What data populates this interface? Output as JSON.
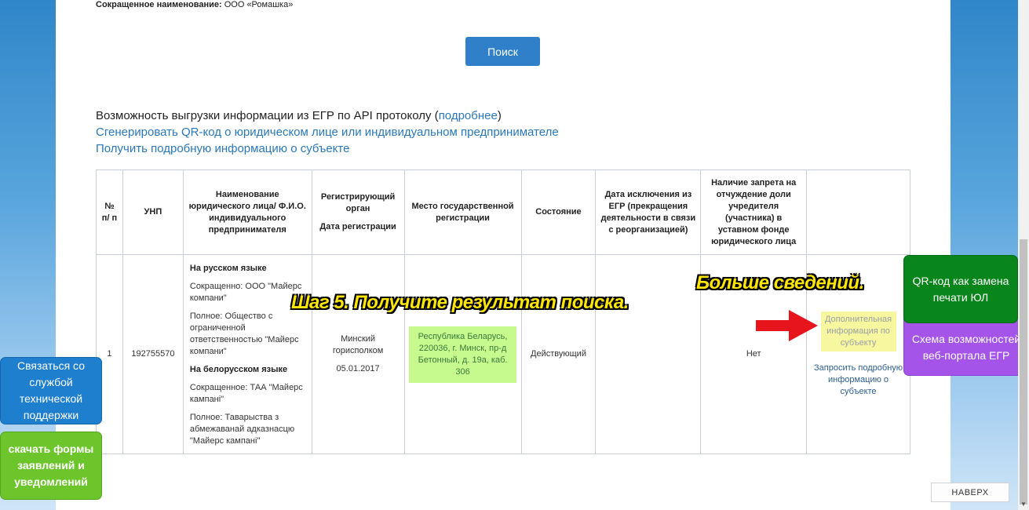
{
  "header": {
    "short_name_label": "Сокращенное наименование:",
    "short_name_value": "ООО «Ромашка»"
  },
  "search_button": "Поиск",
  "links": {
    "api_text": "Возможность выгрузки информации из ЕГР по API протоколу (",
    "api_link": "подробнее",
    "api_close": ")",
    "qr_link": "Сгенерировать QR-код о юридическом лице или индивидуальном предпринимателе",
    "details_link": "Получить подробную информацию о субъекте"
  },
  "table": {
    "headers": [
      "№ п/ п",
      "УНП",
      "Наименование юридического лица/ Ф.И.О. индивидуального предпринимателя",
      "Регистрирующий орган",
      "Место государственной регистрации",
      "Состояние",
      "Дата исключения из ЕГР (прекращения деятельности в связи с реорганизацией)",
      "Наличие запрета на отчуждение доли учредителя (участника) в уставном фонде юридического лица",
      ""
    ],
    "header_reg_date": "Дата регистрации",
    "row": {
      "num": "1",
      "unp": "192755570",
      "ru_title": "На русском языке",
      "ru_short": "Сокращенно: ООО \"Майерс компани\"",
      "ru_full": "Полное: Общество с ограниченной ответственностью \"Майерс компани\"",
      "by_title": "На белорусском языке",
      "by_short": "Сокращенное: ТАА \"Майерс кампані\"",
      "by_full": "Полное: Таварыства з абмежаванай адказнасцю \"Майерс кампані\"",
      "reg_organ": "Минский горисполком",
      "reg_date": "05.01.2017",
      "place": "Республика Беларусь, 220036, г. Минск, пр-д Бетонный, д. 19а, каб. 306",
      "state": "Действующий",
      "exclusion_date": "",
      "ban": "Нет",
      "extra_info": "Дополнительная информация по субъекту",
      "request_info": "Запросить подробную информацию о субъекте"
    }
  },
  "overlays": {
    "step5": "Шаг 5. Получите результат поиска.",
    "more_info": "Больше сведений."
  },
  "floating": {
    "support": "Связаться со службой технической поддержки",
    "forms": "скачать формы заявлений и уведомлений",
    "schema": "Схема возможностей веб-портала ЕГР",
    "qr": "QR-код как замена печати ЮЛ"
  },
  "top_button": "НАВЕРХ",
  "colors": {
    "primary": "#2f80c8",
    "place_highlight": "#c6f98e",
    "info_highlight": "#f7f7a0",
    "overlay_text": "#ffe600",
    "arrow": "#e8141b"
  }
}
